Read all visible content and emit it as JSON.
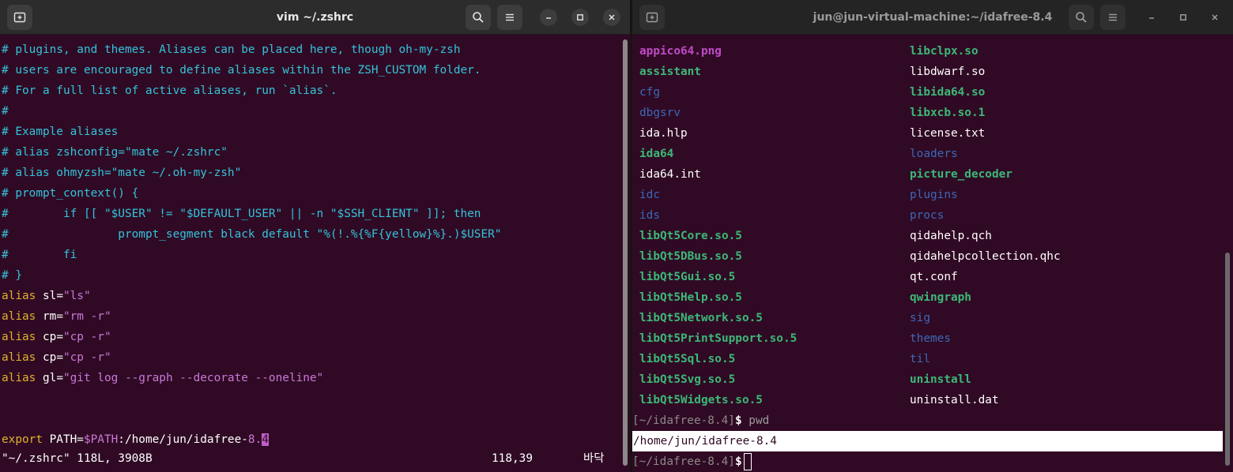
{
  "colors": {
    "terminal_bg": "#300a24",
    "comment": "#34c3dc",
    "keyword": "#e0b030",
    "string": "#c878d8",
    "executable": "#3cb878",
    "directory": "#3c68b8",
    "image": "#c04ac8"
  },
  "icons": {
    "new_tab": "new-tab-icon",
    "search": "search-icon",
    "menu": "hamburger-menu-icon",
    "minimize": "minimize-icon",
    "maximize": "maximize-icon",
    "close": "close-icon"
  },
  "left_window": {
    "title": "vim ~/.zshrc",
    "lines": [
      [
        {
          "t": "# plugins, and themes. Aliases can be placed here, though oh-my-zsh",
          "c": "cmt"
        }
      ],
      [
        {
          "t": "# users are encouraged to define aliases within the ZSH_CUSTOM folder.",
          "c": "cmt"
        }
      ],
      [
        {
          "t": "# For a full list of active aliases, run `alias`.",
          "c": "cmt"
        }
      ],
      [
        {
          "t": "#",
          "c": "cmt"
        }
      ],
      [
        {
          "t": "# Example aliases",
          "c": "cmt"
        }
      ],
      [
        {
          "t": "# alias zshconfig=\"mate ~/.zshrc\"",
          "c": "cmt"
        }
      ],
      [
        {
          "t": "# alias ohmyzsh=\"mate ~/.oh-my-zsh\"",
          "c": "cmt"
        }
      ],
      [
        {
          "t": "# prompt_context() {",
          "c": "cmt"
        }
      ],
      [
        {
          "t": "#        if [[ \"$USER\" != \"$DEFAULT_USER\" || -n \"$SSH_CLIENT\" ]]; then",
          "c": "cmt"
        }
      ],
      [
        {
          "t": "#                prompt_segment black default \"%(!.%{%F{yellow}%}.)$USER\"",
          "c": "cmt"
        }
      ],
      [
        {
          "t": "#        fi",
          "c": "cmt"
        }
      ],
      [
        {
          "t": "# }",
          "c": "cmt"
        }
      ],
      [
        {
          "t": "alias",
          "c": "kw"
        },
        {
          "t": " sl=",
          "c": "norm"
        },
        {
          "t": "\"ls\"",
          "c": "str"
        }
      ],
      [
        {
          "t": "alias",
          "c": "kw"
        },
        {
          "t": " rm=",
          "c": "norm"
        },
        {
          "t": "\"rm -r\"",
          "c": "str"
        }
      ],
      [
        {
          "t": "alias",
          "c": "kw"
        },
        {
          "t": " cp=",
          "c": "norm"
        },
        {
          "t": "\"cp -r\"",
          "c": "str"
        }
      ],
      [
        {
          "t": "alias",
          "c": "kw"
        },
        {
          "t": " cp=",
          "c": "norm"
        },
        {
          "t": "\"cp -r\"",
          "c": "str"
        }
      ],
      [
        {
          "t": "alias",
          "c": "kw"
        },
        {
          "t": " gl=",
          "c": "norm"
        },
        {
          "t": "\"git log --graph --decorate --oneline\"",
          "c": "str"
        }
      ],
      [],
      [],
      [
        {
          "t": "export",
          "c": "kw"
        },
        {
          "t": " PATH=",
          "c": "norm"
        },
        {
          "t": "$PATH",
          "c": "str"
        },
        {
          "t": ":/home/jun/idafree-",
          "c": "norm"
        },
        {
          "t": "8.",
          "c": "str"
        },
        {
          "t": "4",
          "c": "cursor-block"
        }
      ]
    ],
    "status": {
      "file_info": "\"~/.zshrc\" 118L, 3908B",
      "position": "118,39",
      "mode": "바닥"
    }
  },
  "right_window": {
    "title": "jun@jun-virtual-machine:~/idafree-8.4",
    "listing": [
      [
        {
          "t": "appico64.png",
          "k": "img"
        },
        {
          "t": "libclpx.so",
          "k": "exec"
        }
      ],
      [
        {
          "t": "assistant",
          "k": "exec"
        },
        {
          "t": "libdwarf.so",
          "k": "file"
        }
      ],
      [
        {
          "t": "cfg",
          "k": "dir"
        },
        {
          "t": "libida64.so",
          "k": "exec"
        }
      ],
      [
        {
          "t": "dbgsrv",
          "k": "dir"
        },
        {
          "t": "libxcb.so.1",
          "k": "exec"
        }
      ],
      [
        {
          "t": "ida.hlp",
          "k": "file"
        },
        {
          "t": "license.txt",
          "k": "file"
        }
      ],
      [
        {
          "t": "ida64",
          "k": "exec"
        },
        {
          "t": "loaders",
          "k": "dir"
        }
      ],
      [
        {
          "t": "ida64.int",
          "k": "file"
        },
        {
          "t": "picture_decoder",
          "k": "exec"
        }
      ],
      [
        {
          "t": "idc",
          "k": "dir"
        },
        {
          "t": "plugins",
          "k": "dir"
        }
      ],
      [
        {
          "t": "ids",
          "k": "dir"
        },
        {
          "t": "procs",
          "k": "dir"
        }
      ],
      [
        {
          "t": "libQt5Core.so.5",
          "k": "exec"
        },
        {
          "t": "qidahelp.qch",
          "k": "file"
        }
      ],
      [
        {
          "t": "libQt5DBus.so.5",
          "k": "exec"
        },
        {
          "t": "qidahelpcollection.qhc",
          "k": "file"
        }
      ],
      [
        {
          "t": "libQt5Gui.so.5",
          "k": "exec"
        },
        {
          "t": "qt.conf",
          "k": "file"
        }
      ],
      [
        {
          "t": "libQt5Help.so.5",
          "k": "exec"
        },
        {
          "t": "qwingraph",
          "k": "exec"
        }
      ],
      [
        {
          "t": "libQt5Network.so.5",
          "k": "exec"
        },
        {
          "t": "sig",
          "k": "dir"
        }
      ],
      [
        {
          "t": "libQt5PrintSupport.so.5",
          "k": "exec"
        },
        {
          "t": "themes",
          "k": "dir"
        }
      ],
      [
        {
          "t": "libQt5Sql.so.5",
          "k": "exec"
        },
        {
          "t": "til",
          "k": "dir"
        }
      ],
      [
        {
          "t": "libQt5Svg.so.5",
          "k": "exec"
        },
        {
          "t": "uninstall",
          "k": "exec"
        }
      ],
      [
        {
          "t": "libQt5Widgets.so.5",
          "k": "exec"
        },
        {
          "t": "uninstall.dat",
          "k": "file"
        }
      ]
    ],
    "prompt1": {
      "bracket": "[~/idafree-8.4]",
      "dollar": "$",
      "command": " pwd"
    },
    "output": "/home/jun/idafree-8.4",
    "prompt2": {
      "bracket": "[~/idafree-8.4]",
      "dollar": "$"
    }
  }
}
